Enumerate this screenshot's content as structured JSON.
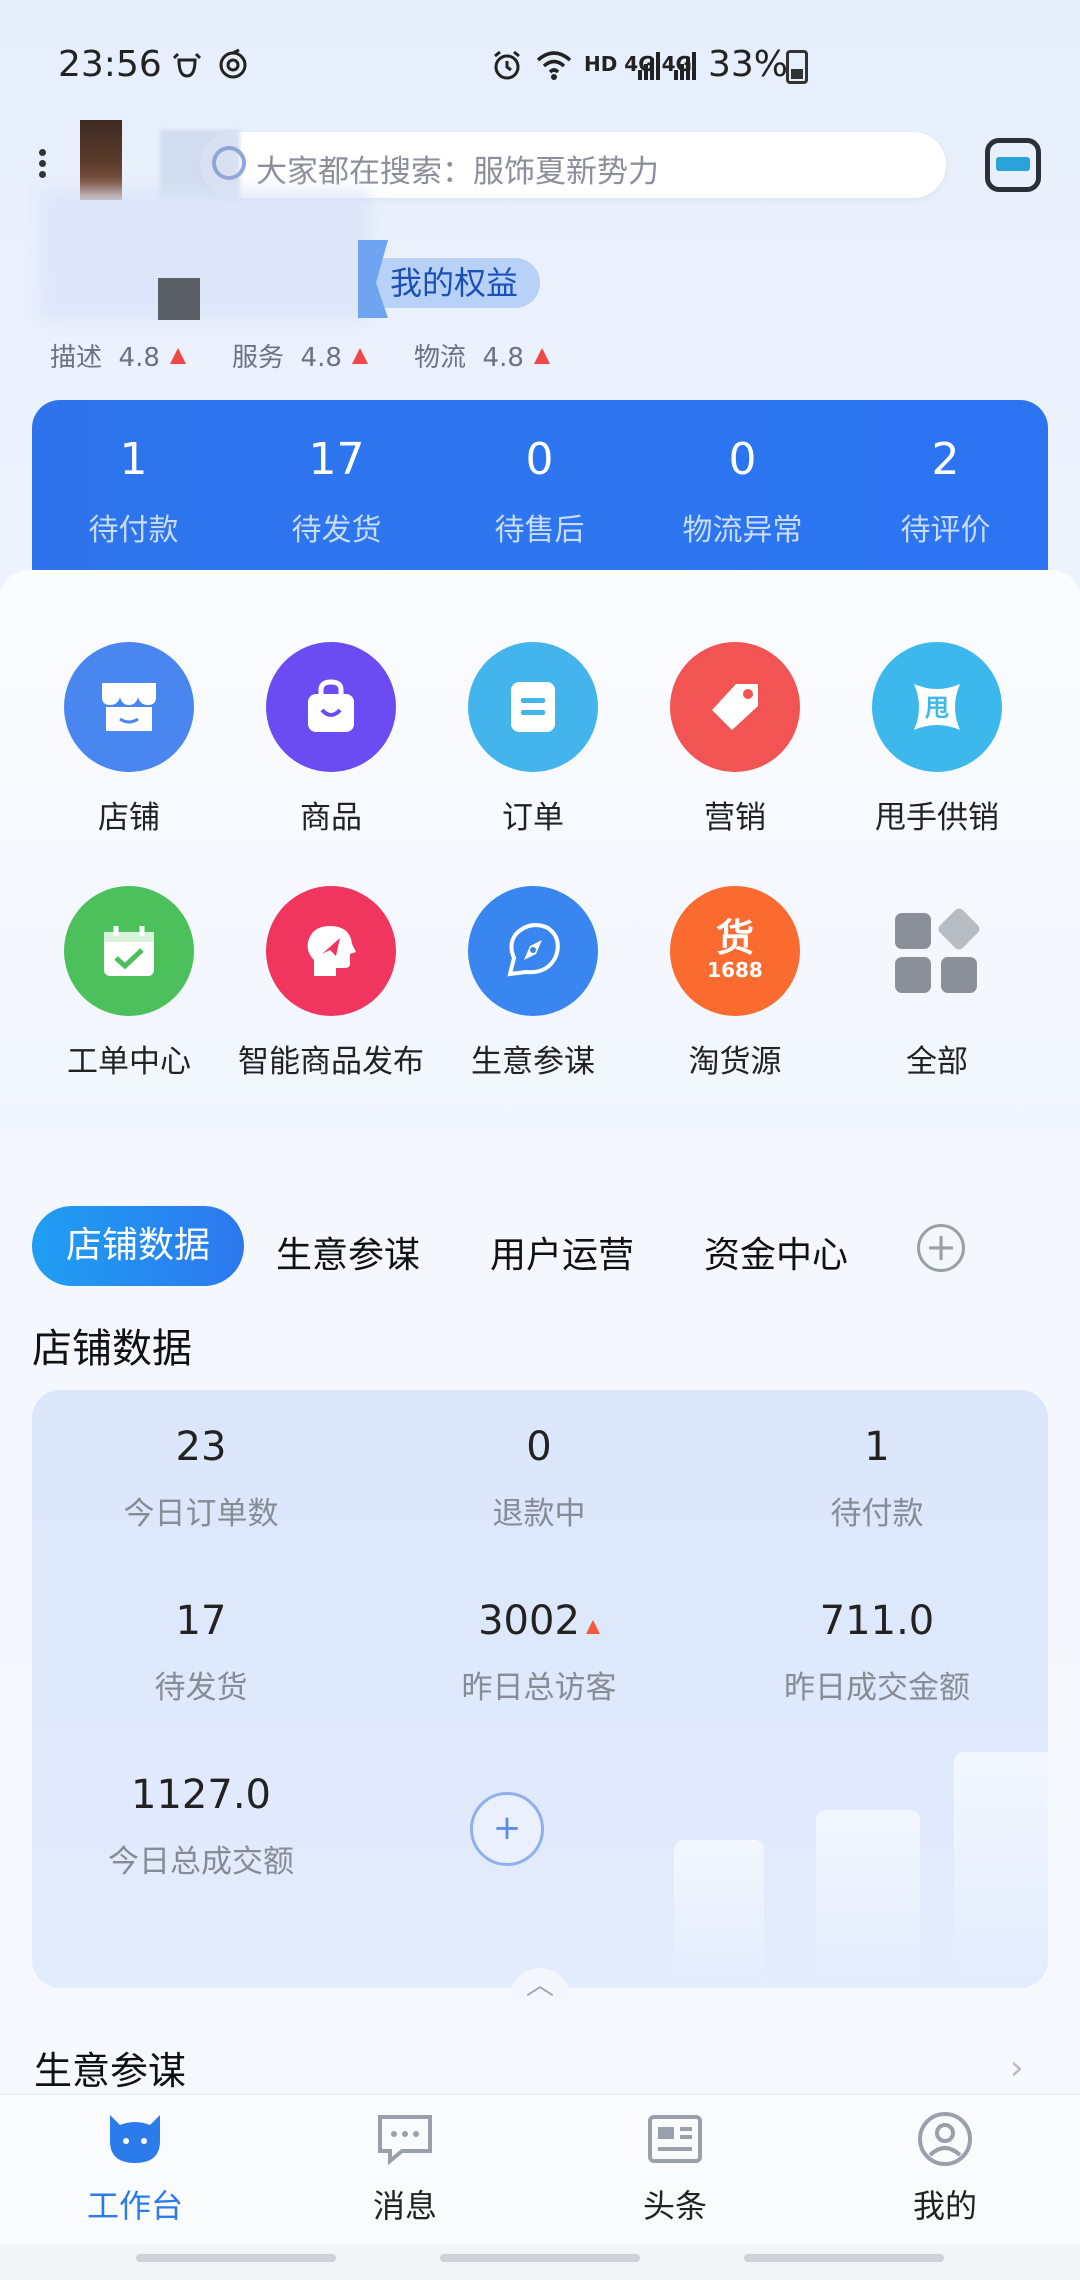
{
  "status_bar": {
    "time": "23:56",
    "network": "HD 4G 4G",
    "battery": "33%"
  },
  "search": {
    "placeholder": "大家都在搜索：服饰夏新势力"
  },
  "shop": {
    "rights_label": "我的权益",
    "ratings": [
      {
        "label": "描述",
        "value": "4.8"
      },
      {
        "label": "服务",
        "value": "4.8"
      },
      {
        "label": "物流",
        "value": "4.8"
      }
    ]
  },
  "orders": [
    {
      "value": "1",
      "label": "待付款"
    },
    {
      "value": "17",
      "label": "待发货"
    },
    {
      "value": "0",
      "label": "待售后"
    },
    {
      "value": "0",
      "label": "物流异常"
    },
    {
      "value": "2",
      "label": "待评价"
    }
  ],
  "grid": {
    "row1": [
      {
        "label": "店铺",
        "icon": "store-icon",
        "color": "#4a86f0"
      },
      {
        "label": "商品",
        "icon": "shopping-bag-icon",
        "color": "#6a4cf2"
      },
      {
        "label": "订单",
        "icon": "order-doc-icon",
        "color": "#43b4ec"
      },
      {
        "label": "营销",
        "icon": "price-tag-icon",
        "color": "#f25454"
      },
      {
        "label": "甩手供销",
        "icon": "supply-icon",
        "color": "#3cb8ec"
      }
    ],
    "row2": [
      {
        "label": "工单中心",
        "icon": "calendar-check-icon",
        "color": "#4cc05a"
      },
      {
        "label": "智能商品发布",
        "icon": "ai-publish-icon",
        "color": "#f0355f"
      },
      {
        "label": "生意参谋",
        "icon": "compass-icon",
        "color": "#3a86f0"
      },
      {
        "label": "淘货源",
        "icon": "source-1688-icon",
        "color": "#fb6a2e"
      },
      {
        "label": "全部",
        "icon": "all-apps-icon",
        "color": "#8a8f99"
      }
    ]
  },
  "tabs": {
    "active": "店铺数据",
    "items": [
      "生意参谋",
      "用户运营",
      "资金中心"
    ]
  },
  "section_title": "店铺数据",
  "stats": [
    {
      "value": "23",
      "label": "今日订单数"
    },
    {
      "value": "0",
      "label": "退款中"
    },
    {
      "value": "1",
      "label": "待付款"
    },
    {
      "value": "17",
      "label": "待发货"
    },
    {
      "value": "3002",
      "label": "昨日总访客"
    },
    {
      "value": "711.0",
      "label": "昨日成交金额"
    },
    {
      "value": "1127.0",
      "label": "今日总成交额"
    }
  ],
  "biz_title": "生意参谋",
  "nav": [
    {
      "label": "工作台",
      "icon": "workbench-icon"
    },
    {
      "label": "消息",
      "icon": "message-icon"
    },
    {
      "label": "头条",
      "icon": "news-icon"
    },
    {
      "label": "我的",
      "icon": "profile-icon"
    }
  ],
  "colors": {
    "primary": "#2b7bea",
    "banner": "#2e73ec"
  }
}
